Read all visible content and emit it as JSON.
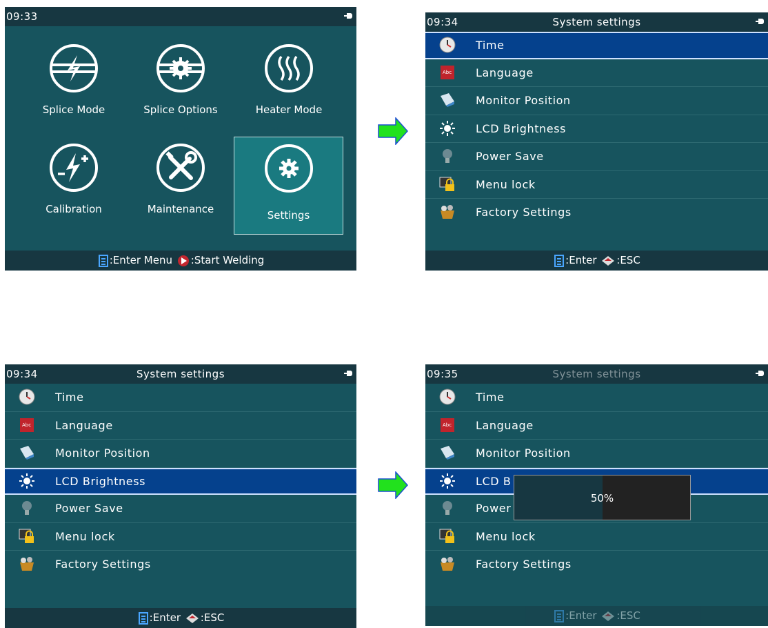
{
  "screen1": {
    "time": "09:33",
    "tiles": [
      {
        "label": "Splice Mode",
        "icon": "splice-mode-icon"
      },
      {
        "label": "Splice Options",
        "icon": "splice-options-icon"
      },
      {
        "label": "Heater Mode",
        "icon": "heater-mode-icon"
      },
      {
        "label": "Calibration",
        "icon": "calibration-icon"
      },
      {
        "label": "Maintenance",
        "icon": "maintenance-icon"
      },
      {
        "label": "Settings",
        "icon": "settings-icon"
      }
    ],
    "selected_tile": "Settings",
    "hint_enter": ":Enter Menu",
    "hint_start": ":Start Welding"
  },
  "screen2": {
    "time": "09:34",
    "title": "System settings",
    "items": [
      "Time",
      "Language",
      "Monitor Position",
      "LCD Brightness",
      "Power Save",
      "Menu lock",
      "Factory Settings"
    ],
    "selected_item": "Time",
    "hint_enter": ":Enter",
    "hint_esc": ":ESC"
  },
  "screen3": {
    "time": "09:34",
    "title": "System settings",
    "items": [
      "Time",
      "Language",
      "Monitor Position",
      "LCD Brightness",
      "Power Save",
      "Menu lock",
      "Factory Settings"
    ],
    "selected_item": "LCD Brightness",
    "hint_enter": ":Enter",
    "hint_esc": ":ESC"
  },
  "screen4": {
    "time": "09:35",
    "title": "System settings",
    "items": [
      "Time",
      "Language",
      "Monitor Position",
      "LCD B",
      "Power",
      "Menu lock",
      "Factory Settings"
    ],
    "selected_item": "LCD Brightness",
    "popup_value_text": "50%",
    "popup_fill_fraction": 0.5,
    "hint_enter": ":Enter",
    "hint_esc": ":ESC"
  },
  "colors": {
    "screen_bg": "#17545e",
    "bar_bg": "#173741",
    "selected_row": "#05418d",
    "selected_tile": "#1a7a80",
    "arrow": "#22e11d"
  }
}
